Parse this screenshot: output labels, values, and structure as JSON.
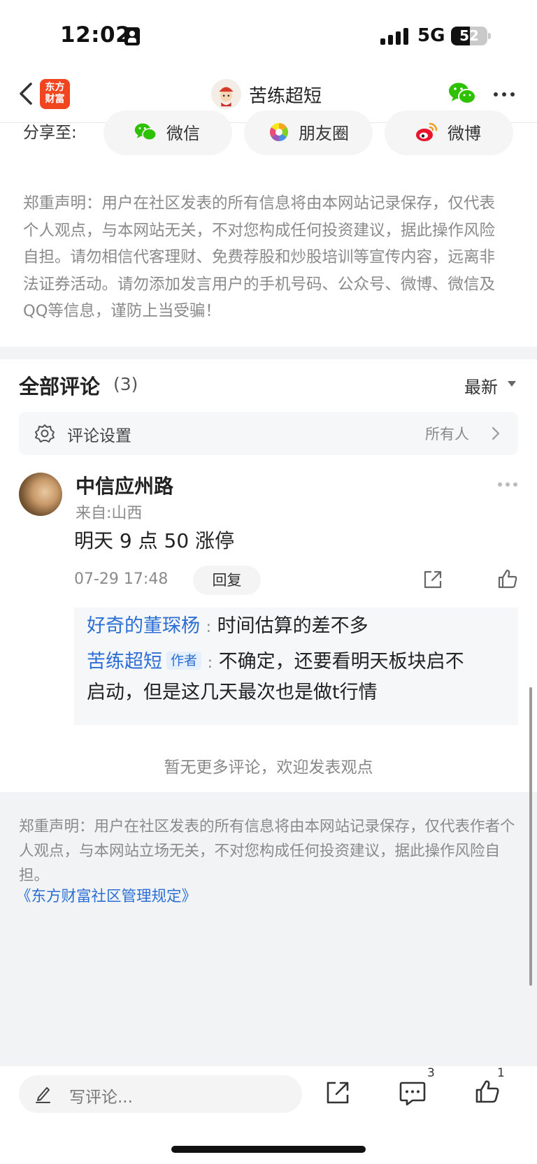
{
  "status_bar": {
    "time": "12:02",
    "network": "5G",
    "battery": "52",
    "battery_level": 0.52
  },
  "header": {
    "logo_line1": "东方",
    "logo_line2": "财富",
    "title": "苦练超短"
  },
  "share": {
    "label": "分享至:",
    "options": [
      {
        "label": "微信",
        "icon": "wechat-icon"
      },
      {
        "label": "朋友圈",
        "icon": "moments-icon"
      },
      {
        "label": "微博",
        "icon": "weibo-icon"
      }
    ]
  },
  "disclaimer_top": "郑重声明：用户在社区发表的所有信息将由本网站记录保存，仅代表个人观点，与本网站无关，不对您构成任何投资建议，据此操作风险自担。请勿相信代客理财、免费荐股和炒股培训等宣传内容，远离非法证券活动。请勿添加发言用户的手机号码、公众号、微博、微信及QQ等信息，谨防上当受骗！",
  "comments": {
    "title": "全部评论",
    "count": "(3)",
    "sort": "最新",
    "settings_label": "评论设置",
    "settings_value": "所有人"
  },
  "comment": {
    "username": "中信应州路",
    "location": "来自:山西",
    "text": "明天 9 点 50 涨停",
    "time": "07-29 17:48",
    "reply_label": "回复",
    "replies": [
      {
        "user": "好奇的董琛杨",
        "colon": ":",
        "text": "时间估算的差不多"
      },
      {
        "user": "苦练超短",
        "tag": "作者",
        "colon": ":",
        "text": "不确定，还要看明天板块启不",
        "text2": "启动，但是这几天最次也是做t行情"
      }
    ]
  },
  "no_more": "暂无更多评论，欢迎发表观点",
  "disclaimer_bottom": "郑重声明：用户在社区发表的所有信息将由本网站记录保存，仅代表作者个人观点，与本网站立场无关，不对您构成任何投资建议，据此操作风险自担。",
  "rules_link": "《东方财富社区管理规定》",
  "bottom_bar": {
    "placeholder": "写评论...",
    "comment_count": "3",
    "like_count": "1"
  },
  "colors": {
    "brand": "#f0451f",
    "link": "#2b6fd6",
    "wechat": "#2dc100"
  }
}
